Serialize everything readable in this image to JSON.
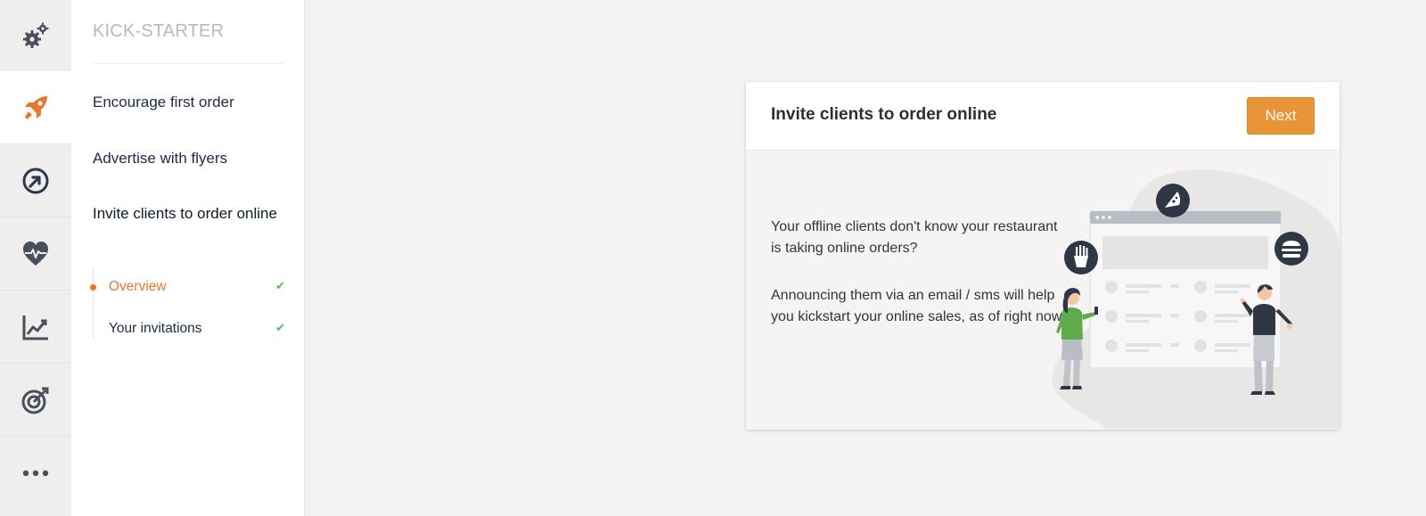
{
  "rail": {
    "items": [
      {
        "icon": "gears-icon",
        "active": false
      },
      {
        "icon": "rocket-icon",
        "active": true
      },
      {
        "icon": "arrow-circle-icon",
        "active": false
      },
      {
        "icon": "heartbeat-icon",
        "active": false
      },
      {
        "icon": "chart-line-icon",
        "active": false
      },
      {
        "icon": "target-icon",
        "active": false
      },
      {
        "icon": "more-icon",
        "active": false
      }
    ],
    "accent": "#e8772e",
    "icon_color": "#4a4f5c"
  },
  "subnav": {
    "title": "KICK-STARTER",
    "links": [
      {
        "label": "Encourage first order"
      },
      {
        "label": "Advertise with flyers"
      },
      {
        "label": "Invite clients to order online"
      }
    ],
    "steps": [
      {
        "label": "Overview",
        "active": true,
        "done": true
      },
      {
        "label": "Your invitations",
        "active": false,
        "done": true
      }
    ],
    "check_glyph": "✔"
  },
  "card": {
    "title": "Invite clients to order online",
    "next_label": "Next",
    "paragraph_1": "Your offline clients don't know your restaurant is taking online orders?",
    "paragraph_2": "Announcing them via an email / sms will help you kickstart your online sales, as of right now.",
    "button_color": "#ea9438"
  }
}
